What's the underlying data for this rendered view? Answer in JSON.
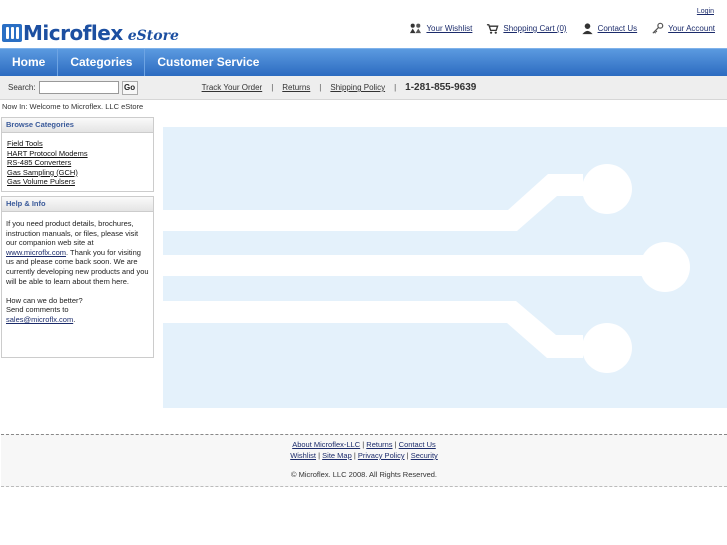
{
  "header": {
    "login": "Login",
    "logo_text": "Microflex",
    "logo_sub": "eStore",
    "links": [
      {
        "label": "Your Wishlist",
        "icon": "people-icon"
      },
      {
        "label": "Shopping Cart (0)",
        "icon": "cart-icon"
      },
      {
        "label": "Contact Us",
        "icon": "user-icon"
      },
      {
        "label": "Your Account",
        "icon": "key-icon"
      }
    ]
  },
  "nav": {
    "items": [
      "Home",
      "Categories",
      "Customer Service"
    ]
  },
  "subbar": {
    "search_label": "Search:",
    "search_value": "",
    "go_label": "Go",
    "links": [
      "Track Your Order",
      "Returns",
      "Shipping Policy"
    ],
    "phone": "1-281-855-9639"
  },
  "breadcrumb": "Now In: Welcome to Microflex. LLC eStore",
  "categories": {
    "title": "Browse Categories",
    "items": [
      "Field Tools",
      "HART Protocol Modems",
      "RS-485 Converters",
      "Gas Sampling (GCH)",
      "Gas Volume Pulsers"
    ]
  },
  "help": {
    "title": "Help & Info",
    "p1_before": "If you need product details, brochures, instruction manuals, or files, please visit our companion web site at",
    "p1_link": "www.microflx.com",
    "p1_after": ". Thank you for visiting us and please come back soon.  We are currently developing new products and you will be able to learn about them here.",
    "p2_line1": "How can we do better?",
    "p2_line2": "Send comments to",
    "p2_email": "sales@microflx.com",
    "p2_end": "."
  },
  "footer": {
    "row1": [
      "About Microflex-LLC",
      "Returns",
      "Contact Us"
    ],
    "row2": [
      "Wishlist",
      "Site Map",
      "Privacy Policy",
      "Security"
    ],
    "copyright": "© Microflex. LLC 2008. All Rights Reserved."
  },
  "colors": {
    "nav_blue": "#2c6bc0",
    "brand_blue": "#1c4fa1",
    "hero_bg": "#e4f1fb",
    "hero_trace": "#ffffff"
  }
}
